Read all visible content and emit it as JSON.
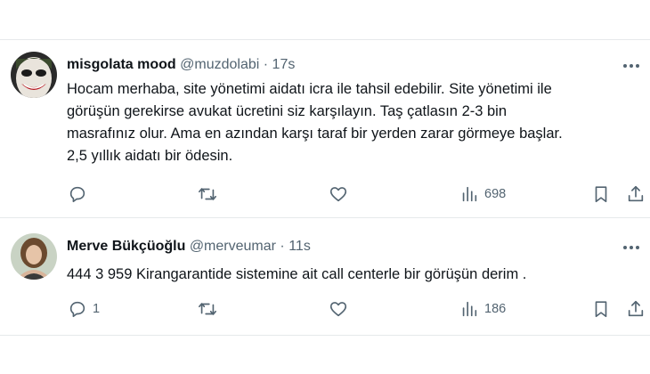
{
  "tweets": [
    {
      "author_name": "misgolata mood",
      "handle": "@muzdolabi",
      "separator": "·",
      "time": "17s",
      "lines": [
        "Hocam merhaba, site yönetimi aidatı icra ile tahsil edebilir. Site yönetimi ile",
        "görüşün gerekirse avukat ücretini siz karşılayın. Taş çatlasın 2-3 bin",
        "masrafınız olur. Ama en azından karşı taraf bir yerden zarar görmeye başlar.",
        "2,5 yıllık aidatı bir ödesin."
      ],
      "reply_count": "",
      "retweet_count": "",
      "like_count": "",
      "views": "698"
    },
    {
      "author_name": "Merve Bükçüoğlu",
      "handle": "@merveumar",
      "separator": "·",
      "time": "11s",
      "lines": [
        "444 3 959 Kirangarantide sistemine ait call centerle bir görüşün derim ."
      ],
      "reply_count": "1",
      "retweet_count": "",
      "like_count": "",
      "views": "186"
    }
  ],
  "icons": {
    "more": "more-icon",
    "reply": "reply-icon",
    "retweet": "retweet-icon",
    "like": "heart-icon",
    "views": "views-icon",
    "bookmark": "bookmark-icon",
    "share": "share-icon"
  },
  "colors": {
    "text": "#0f1419",
    "secondary": "#536471",
    "divider": "#e6e9eb"
  }
}
